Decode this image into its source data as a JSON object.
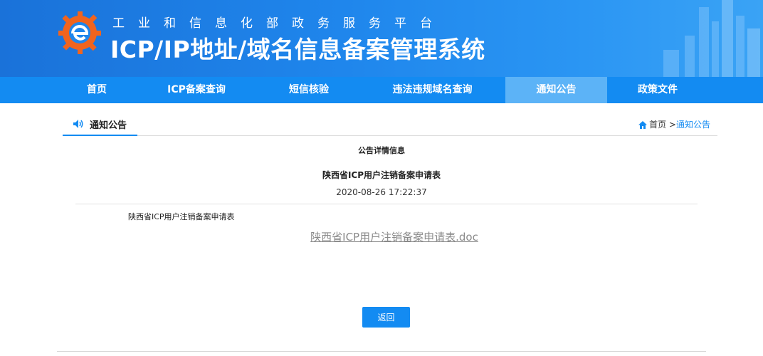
{
  "header": {
    "org_title": "工业和信息化部政务服务平台",
    "system_title": "ICP/IP地址/域名信息备案管理系统"
  },
  "nav": {
    "items": [
      {
        "label": "首页"
      },
      {
        "label": "ICP备案查询"
      },
      {
        "label": "短信核验"
      },
      {
        "label": "违法违规域名查询"
      },
      {
        "label": "通知公告",
        "active": true
      },
      {
        "label": "政策文件"
      }
    ]
  },
  "section": {
    "label": "通知公告",
    "breadcrumb": {
      "home": "首页",
      "separator": ">",
      "current": "通知公告"
    }
  },
  "notice": {
    "detail_heading": "公告详情信息",
    "title": "陕西省ICP用户注销备案申请表",
    "datetime": "2020-08-26 17:22:37",
    "body": "陕西省ICP用户注销备案申请表",
    "attachment": "陕西省ICP用户注销备案申请表.doc"
  },
  "actions": {
    "back_label": "返回"
  },
  "colors": {
    "primary": "#138bf2",
    "nav_active": "#5cb3f7",
    "banner": "#1f86ec",
    "logo_orange": "#f0641e"
  },
  "icons": [
    "logo-gear-icon",
    "speaker-icon",
    "home-icon"
  ]
}
